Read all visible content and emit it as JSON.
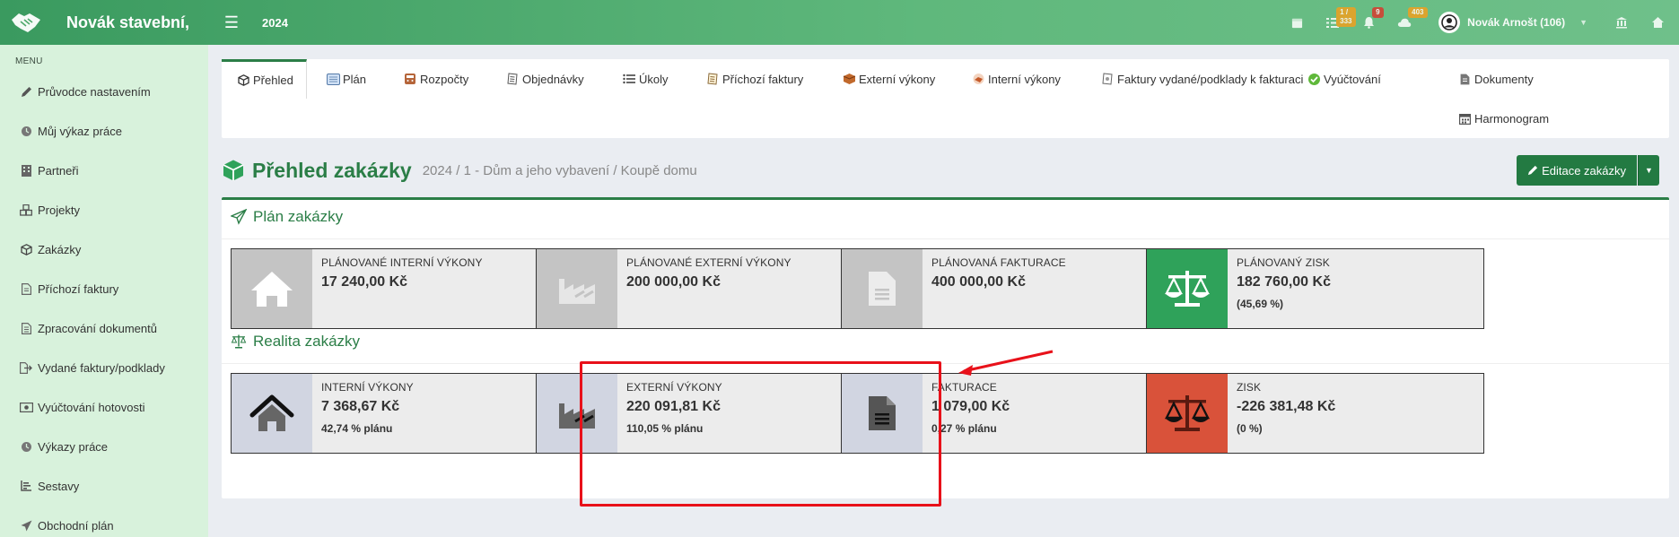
{
  "topbar": {
    "company": "Novák stavební,",
    "year": "2024",
    "badges": {
      "tasks": "1 / 333",
      "notifications": "9",
      "cloud": "403"
    },
    "user_name": "Novák Arnošt (106)"
  },
  "sidebar": {
    "menu_label": "MENU",
    "items": [
      {
        "label": "Průvodce nastavením",
        "icon": "pencil-icon"
      },
      {
        "label": "Můj výkaz práce",
        "icon": "clock-icon"
      },
      {
        "label": "Partneři",
        "icon": "building-icon"
      },
      {
        "label": "Projekty",
        "icon": "cubes-icon"
      },
      {
        "label": "Zakázky",
        "icon": "cube-icon"
      },
      {
        "label": "Příchozí faktury",
        "icon": "file-icon"
      },
      {
        "label": "Zpracování dokumentů",
        "icon": "file-text-icon"
      },
      {
        "label": "Vydané faktury/podklady",
        "icon": "export-icon"
      },
      {
        "label": "Vyúčtování hotovosti",
        "icon": "money-icon"
      },
      {
        "label": "Výkazy práce",
        "icon": "clock-icon"
      },
      {
        "label": "Sestavy",
        "icon": "report-icon"
      },
      {
        "label": "Obchodní plán",
        "icon": "paper-plane-icon"
      }
    ]
  },
  "tabs": [
    {
      "label": "Přehled"
    },
    {
      "label": "Plán"
    },
    {
      "label": "Rozpočty"
    },
    {
      "label": "Objednávky"
    },
    {
      "label": "Úkoly"
    },
    {
      "label": "Příchozí faktury"
    },
    {
      "label": "Externí výkony"
    },
    {
      "label": "Interní výkony"
    },
    {
      "label": "Faktury vydané/podklady k fakturaci"
    },
    {
      "label": "Vyúčtování"
    },
    {
      "label": "Dokumenty"
    },
    {
      "label": "Harmonogram"
    }
  ],
  "header": {
    "title": "Přehled zakázky",
    "subtitle": "2024 / 1 - Dům a jeho vybavení / Koupě domu",
    "edit_button": "Editace zakázky"
  },
  "plan": {
    "title": "Plán zakázky",
    "boxes": [
      {
        "label": "Plánované interní výkony",
        "value": "17 240,00 Kč",
        "note": ""
      },
      {
        "label": "Plánované externí výkony",
        "value": "200 000,00 Kč",
        "note": ""
      },
      {
        "label": "Plánovaná fakturace",
        "value": "400 000,00 Kč",
        "note": ""
      },
      {
        "label": "Plánovaný zisk",
        "value": "182 760,00 Kč",
        "note": "(45,69 %)"
      }
    ]
  },
  "reality": {
    "title": "Realita zakázky",
    "boxes": [
      {
        "label": "Interní výkony",
        "value": "7 368,67 Kč",
        "note": "42,74 % plánu"
      },
      {
        "label": "Externí výkony",
        "value": "220 091,81 Kč",
        "note": "110,05 % plánu"
      },
      {
        "label": "Fakturace",
        "value": "1 079,00 Kč",
        "note": "0,27 % plánu"
      },
      {
        "label": "Zisk",
        "value": "-226 381,48 Kč",
        "note": "(0 %)"
      }
    ]
  },
  "colors": {
    "brand": "#2b7e47",
    "highlight": "#e8111a",
    "profit_plan": "#2fa25a",
    "profit_real": "#d9523a"
  }
}
